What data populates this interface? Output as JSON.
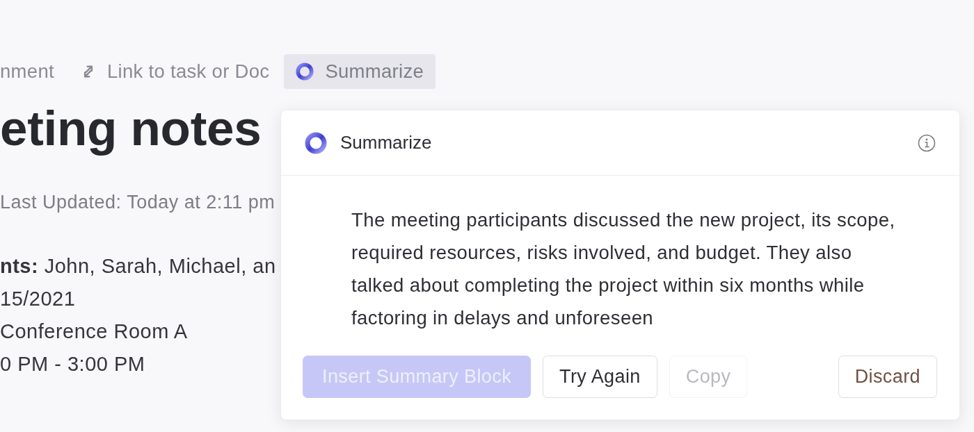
{
  "toolbar": {
    "items": [
      {
        "kind": "text",
        "label": "nment",
        "selected": false
      },
      {
        "kind": "link",
        "label": "Link to task or Doc",
        "selected": false
      },
      {
        "kind": "ai",
        "label": "Summarize",
        "selected": true
      }
    ]
  },
  "doc": {
    "title": "eting notes",
    "updated": "Last Updated: Today at 2:11 pm",
    "details": [
      "**nts:** John, Sarah, Michael, an",
      "15/2021",
      "Conference Room A",
      "0 PM - 3:00 PM"
    ]
  },
  "panel": {
    "title": "Summarize",
    "summary": "The meeting participants discussed the new project, its scope, required resources, risks involved, and budget. They also talked about completing the project within six months while factoring in delays and unforeseen",
    "buttons": [
      {
        "label": "Insert Summary Block",
        "kind": "primary",
        "disabled": true
      },
      {
        "label": "Try Again",
        "kind": "secondary",
        "disabled": false
      },
      {
        "label": "Copy",
        "kind": "secondary",
        "disabled": true
      },
      {
        "label": "Discard",
        "kind": "danger",
        "disabled": false
      }
    ]
  }
}
